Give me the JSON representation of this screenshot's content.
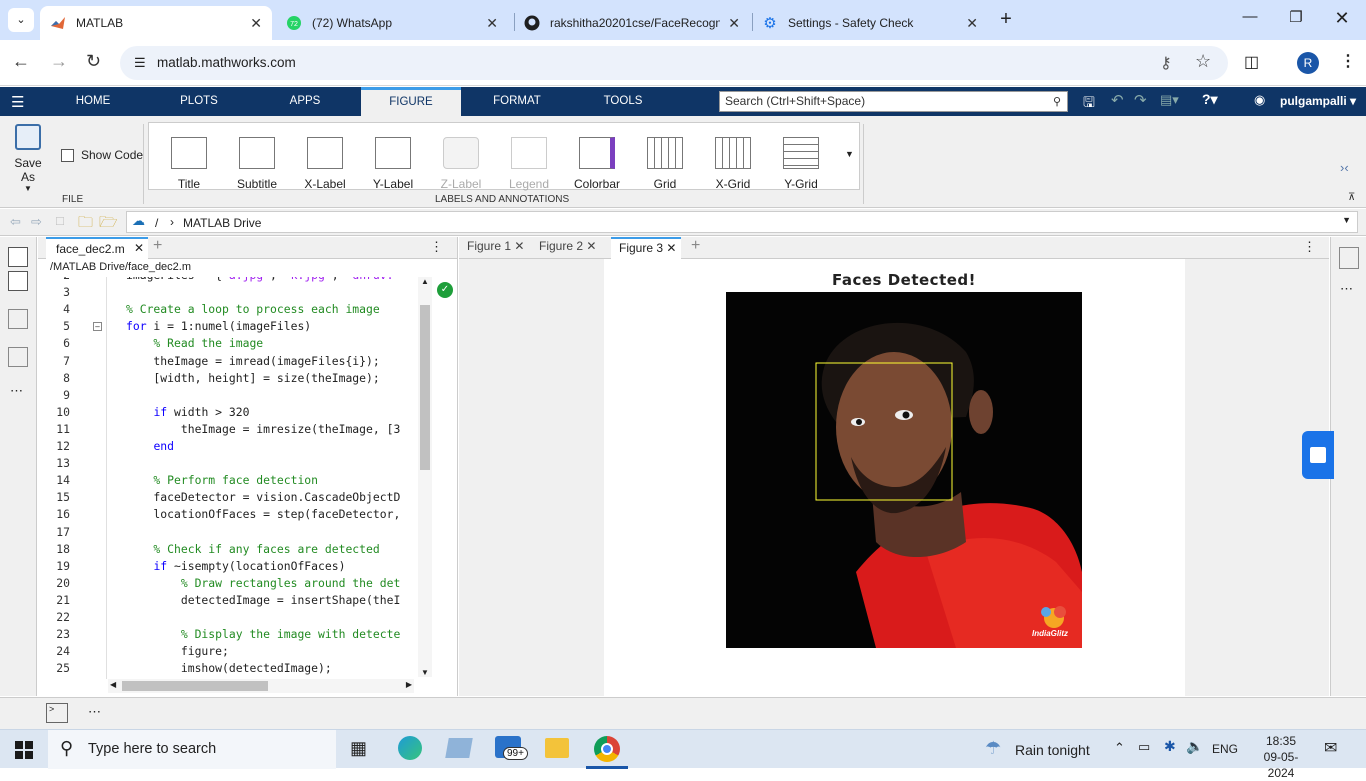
{
  "browser": {
    "tabs": [
      {
        "title": "MATLAB",
        "icon": "matlab-logo-icon",
        "active": true
      },
      {
        "title": "(72) WhatsApp",
        "icon": "whatsapp-icon",
        "badge": "72"
      },
      {
        "title": "rakshitha20201cse/FaceRecogniti",
        "icon": "github-icon"
      },
      {
        "title": "Settings - Safety Check",
        "icon": "gear-icon"
      }
    ],
    "url": "matlab.mathworks.com",
    "profile_initial": "R"
  },
  "toolstrip": {
    "tabs": [
      "HOME",
      "PLOTS",
      "APPS",
      "FIGURE",
      "FORMAT",
      "TOOLS"
    ],
    "active_tab": "FIGURE",
    "search_placeholder": "Search (Ctrl+Shift+Space)",
    "user": "pulgampalli",
    "file_group": {
      "save_as": "Save As",
      "show_code": "Show Code",
      "label": "FILE"
    },
    "labels_group": {
      "buttons": [
        "Title",
        "Subtitle",
        "X-Label",
        "Y-Label",
        "Z-Label",
        "Legend",
        "Colorbar",
        "Grid",
        "X-Grid",
        "Y-Grid"
      ],
      "label": "LABELS AND ANNOTATIONS"
    }
  },
  "path": {
    "root": "/",
    "folder": "MATLAB Drive"
  },
  "editor": {
    "tab": "face_dec2.m",
    "filepath": "/MATLAB Drive/face_dec2.m",
    "lines": [
      {
        "n": "2",
        "text": "imageFiles = {'a.jpg', 'k.jpg', 'dhruv."
      },
      {
        "n": "3",
        "text": ""
      },
      {
        "n": "4",
        "text": "% Create a loop to process each image"
      },
      {
        "n": "5",
        "text": "for i = 1:numel(imageFiles)"
      },
      {
        "n": "6",
        "text": "    % Read the image"
      },
      {
        "n": "7",
        "text": "    theImage = imread(imageFiles{i});"
      },
      {
        "n": "8",
        "text": "    [width, height] = size(theImage);"
      },
      {
        "n": "9",
        "text": ""
      },
      {
        "n": "10",
        "text": "    if width > 320"
      },
      {
        "n": "11",
        "text": "        theImage = imresize(theImage, [3"
      },
      {
        "n": "12",
        "text": "    end"
      },
      {
        "n": "13",
        "text": ""
      },
      {
        "n": "14",
        "text": "    % Perform face detection"
      },
      {
        "n": "15",
        "text": "    faceDetector = vision.CascadeObjectD"
      },
      {
        "n": "16",
        "text": "    locationOfFaces = step(faceDetector,"
      },
      {
        "n": "17",
        "text": ""
      },
      {
        "n": "18",
        "text": "    % Check if any faces are detected"
      },
      {
        "n": "19",
        "text": "    if ~isempty(locationOfFaces)"
      },
      {
        "n": "20",
        "text": "        % Draw rectangles around the det"
      },
      {
        "n": "21",
        "text": "        detectedImage = insertShape(theI"
      },
      {
        "n": "22",
        "text": ""
      },
      {
        "n": "23",
        "text": "        % Display the image with detecte"
      },
      {
        "n": "24",
        "text": "        figure;"
      },
      {
        "n": "25",
        "text": "        imshow(detectedImage);"
      }
    ]
  },
  "figures": {
    "tabs": [
      "Figure 1",
      "Figure 2",
      "Figure 3"
    ],
    "active": "Figure 3",
    "title": "Faces Detected!",
    "watermark": "IndiaGlitz"
  },
  "taskbar": {
    "search_placeholder": "Type here to search",
    "weather": "Rain tonight",
    "language": "ENG",
    "time": "18:35",
    "date": "09-05-2024",
    "mail_badge": "99+"
  }
}
